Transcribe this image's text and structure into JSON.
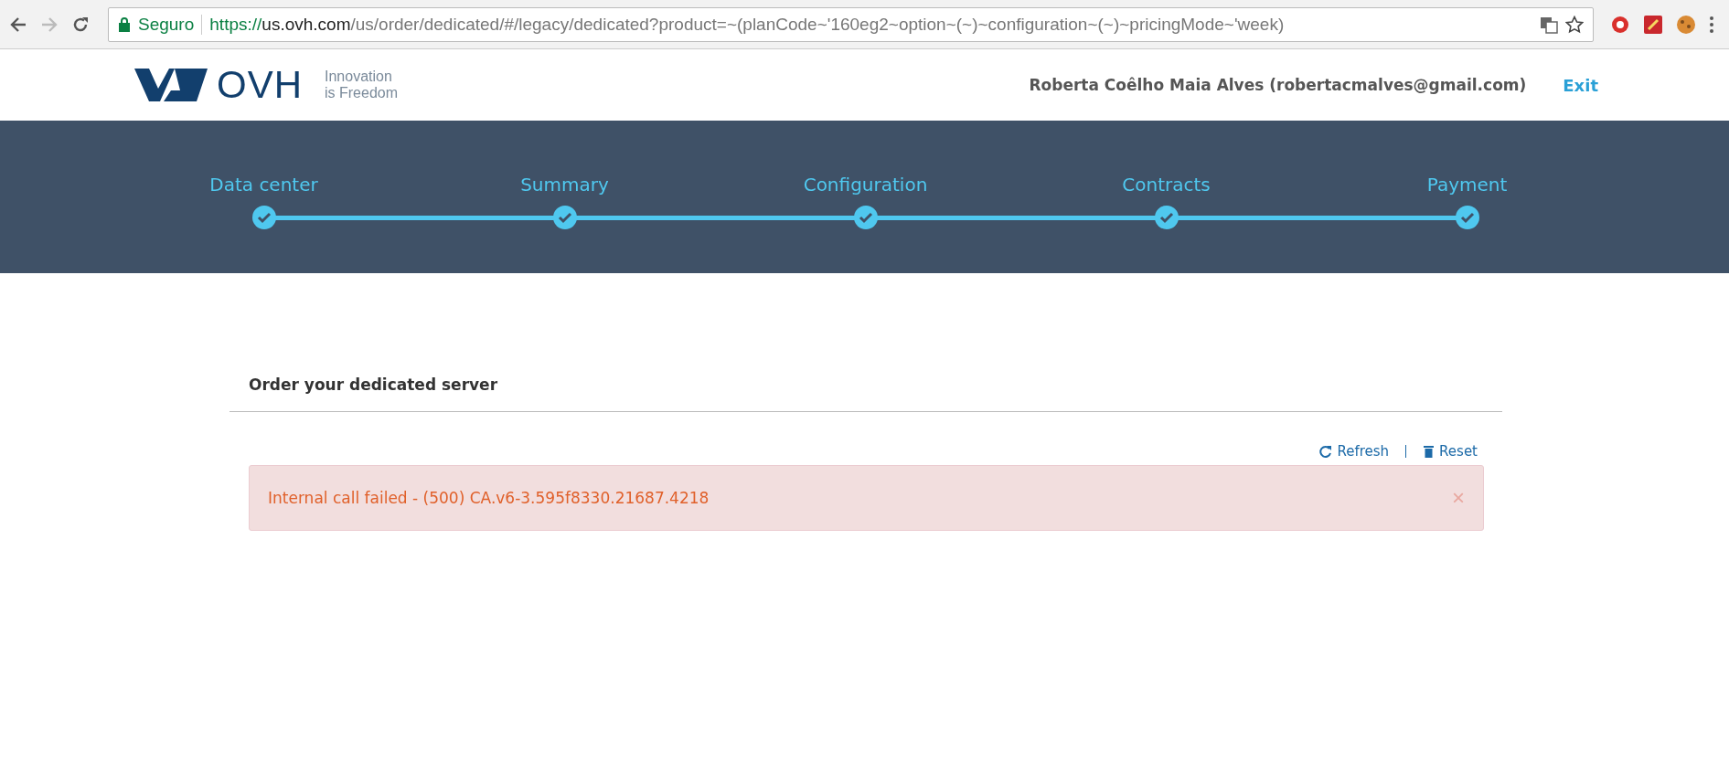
{
  "browser": {
    "security_label": "Seguro",
    "url_host_prefix": "https://",
    "url_host": "us.ovh.com",
    "url_path": "/us/order/dedicated/#/legacy/dedicated?product=~(planCode~'160eg2~option~(~)~configuration~(~)~pricingMode~'week)"
  },
  "header": {
    "brand": "OVH",
    "tagline_1": "Innovation",
    "tagline_2": "is Freedom",
    "user": "Roberta Coêlho Maia Alves (robertacmalves@gmail.com)",
    "exit": "Exit"
  },
  "steps": [
    {
      "label": "Data center",
      "done": true
    },
    {
      "label": "Summary",
      "done": true
    },
    {
      "label": "Configuration",
      "done": true
    },
    {
      "label": "Contracts",
      "done": true
    },
    {
      "label": "Payment",
      "done": true
    }
  ],
  "panel": {
    "title": "Order your dedicated server",
    "refresh": "Refresh",
    "reset": "Reset",
    "alert": {
      "message": "Internal call failed - (500) CA.v6-3.595f8330.21687.4218",
      "close": "×"
    }
  }
}
